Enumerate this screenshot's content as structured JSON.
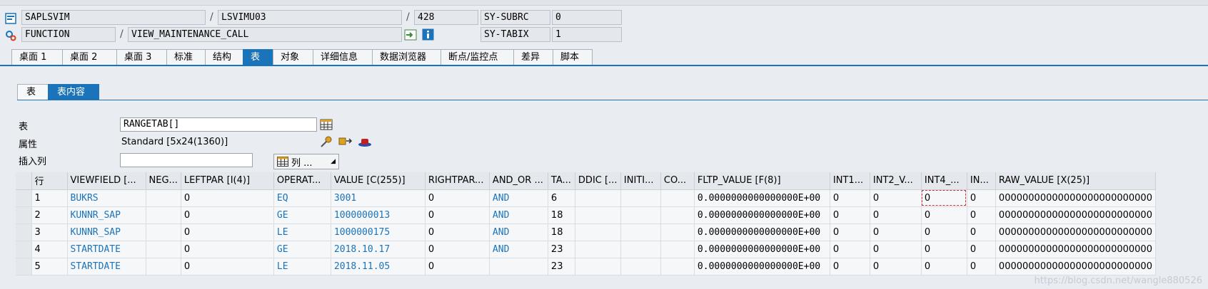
{
  "header": {
    "row1": {
      "program": "SAPLSVIM",
      "include": "LSVIMU03",
      "line": "428",
      "sysvar_label": "SY-SUBRC",
      "sysvar_value": "0"
    },
    "row2": {
      "event_type": "FUNCTION",
      "event": "VIEW_MAINTENANCE_CALL",
      "sysvar_label": "SY-TABIX",
      "sysvar_value": "1"
    }
  },
  "tabs": [
    "桌面 1",
    "桌面 2",
    "桌面 3",
    "标准",
    "结构",
    "表",
    "对象",
    "详细信息",
    "数据浏览器",
    "断点/监控点",
    "差异",
    "脚本"
  ],
  "subtabs": [
    "表",
    "表内容"
  ],
  "attributes": {
    "table_label": "表",
    "table_value": "RANGETAB[]",
    "attr_label": "属性",
    "attr_value": "Standard [5x24(1360)]",
    "insert_label": "插入列",
    "insert_value": "",
    "column_button": "列 ..."
  },
  "grid": {
    "columns": [
      "行",
      "VIEWFIELD [...",
      "NEG...",
      "LEFTPAR [I(4)]",
      "OPERAT...",
      "VALUE [C(255)]",
      "RIGHTPAR...",
      "AND_OR ...",
      "TA...",
      "DDIC [...",
      "INITI...",
      "CO...",
      "FLTP_VALUE [F(8)]",
      "INT1...",
      "INT2_V...",
      "INT4_...",
      "IN...",
      "RAW_VALUE [X(25)]"
    ],
    "rows": [
      [
        "1",
        "BUKRS",
        "",
        "0",
        "EQ",
        "3001",
        "0",
        "AND",
        "6",
        "",
        "",
        "",
        "0.0000000000000000E+00",
        "0",
        "0",
        "0",
        "0",
        "00000000000000000000000000"
      ],
      [
        "2",
        "KUNNR_SAP",
        "",
        "0",
        "GE",
        "1000000013",
        "0",
        "AND",
        "18",
        "",
        "",
        "",
        "0.0000000000000000E+00",
        "0",
        "0",
        "0",
        "0",
        "00000000000000000000000000"
      ],
      [
        "3",
        "KUNNR_SAP",
        "",
        "0",
        "LE",
        "1000000175",
        "0",
        "AND",
        "18",
        "",
        "",
        "",
        "0.0000000000000000E+00",
        "0",
        "0",
        "0",
        "0",
        "00000000000000000000000000"
      ],
      [
        "4",
        "STARTDATE",
        "",
        "0",
        "GE",
        "2018.10.17",
        "0",
        "AND",
        "23",
        "",
        "",
        "",
        "0.0000000000000000E+00",
        "0",
        "0",
        "0",
        "0",
        "00000000000000000000000000"
      ],
      [
        "5",
        "STARTDATE",
        "",
        "0",
        "LE",
        "2018.11.05",
        "0",
        "",
        "23",
        "",
        "",
        "",
        "0.0000000000000000E+00",
        "0",
        "0",
        "0",
        "0",
        "00000000000000000000000000"
      ]
    ]
  },
  "watermark": "https://blog.csdn.net/wangle880526",
  "colors": {
    "accent": "#1b73b9",
    "link": "#1b73b9"
  }
}
